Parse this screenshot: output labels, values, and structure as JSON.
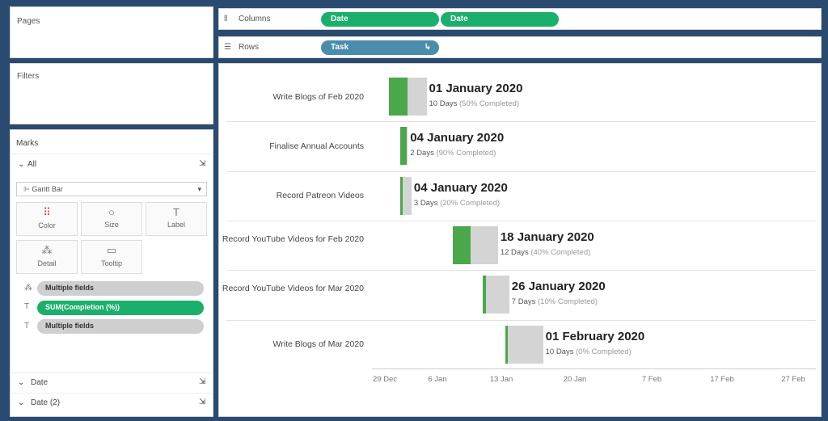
{
  "pages": {
    "title": "Pages"
  },
  "filters": {
    "title": "Filters"
  },
  "marks": {
    "title": "Marks",
    "all_label": "All",
    "mark_type": "Gantt Bar",
    "buttons": [
      {
        "label": "Color",
        "icon": "color-icon"
      },
      {
        "label": "Size",
        "icon": "size-icon"
      },
      {
        "label": "Label",
        "icon": "label-icon"
      },
      {
        "label": "Detail",
        "icon": "detail-icon"
      },
      {
        "label": "Tooltip",
        "icon": "tooltip-icon"
      }
    ],
    "pills": [
      {
        "label": "Multiple fields",
        "style": "grey"
      },
      {
        "label": "SUM(Completion (%))",
        "style": "green"
      },
      {
        "label": "Multiple fields",
        "style": "grey"
      }
    ],
    "sections": [
      {
        "label": "Date"
      },
      {
        "label": "Date (2)"
      }
    ]
  },
  "shelves": {
    "columns_label": "Columns",
    "columns_pills": [
      "Date",
      "Date"
    ],
    "rows_label": "Rows",
    "rows_pills": [
      "Task"
    ]
  },
  "tasks": [
    {
      "name": "Write Blogs of Feb 2020",
      "date_label": "01 January 2020",
      "days_text": "10 Days",
      "pct_text": "(50% Completed)"
    },
    {
      "name": "Finalise Annual Accounts",
      "date_label": "04 January 2020",
      "days_text": "2 Days",
      "pct_text": "(90% Completed)"
    },
    {
      "name": "Record Patreon Videos",
      "date_label": "04 January 2020",
      "days_text": "3 Days",
      "pct_text": "(20% Completed)"
    },
    {
      "name": "Record YouTube Videos for Feb 2020",
      "date_label": "18 January 2020",
      "days_text": "12 Days",
      "pct_text": "(40% Completed)"
    },
    {
      "name": "Record YouTube Videos for Mar 2020",
      "date_label": "26 January 2020",
      "days_text": "7 Days",
      "pct_text": "(10% Completed)"
    },
    {
      "name": "Write Blogs of Mar 2020",
      "date_label": "01 February 2020",
      "days_text": "10 Days",
      "pct_text": "(0% Completed)"
    }
  ],
  "chart_data": {
    "type": "gantt",
    "x_axis_ticks": [
      "29 Dec",
      "6 Jan",
      "13 Jan",
      "20 Jan",
      "7 Feb",
      "17 Feb",
      "27 Feb"
    ],
    "series": [
      {
        "task": "Write Blogs of Feb 2020",
        "start": "2020-01-01",
        "days": 10,
        "completion": 0.5
      },
      {
        "task": "Finalise Annual Accounts",
        "start": "2020-01-04",
        "days": 2,
        "completion": 0.9
      },
      {
        "task": "Record Patreon Videos",
        "start": "2020-01-04",
        "days": 3,
        "completion": 0.2
      },
      {
        "task": "Record YouTube Videos for Feb 2020",
        "start": "2020-01-18",
        "days": 12,
        "completion": 0.4
      },
      {
        "task": "Record YouTube Videos for Mar 2020",
        "start": "2020-01-26",
        "days": 7,
        "completion": 0.1
      },
      {
        "task": "Write Blogs of Mar 2020",
        "start": "2020-02-01",
        "days": 10,
        "completion": 0.0
      }
    ],
    "colors": {
      "completed": "#4aa84a",
      "remaining": "#d4d4d4"
    }
  }
}
